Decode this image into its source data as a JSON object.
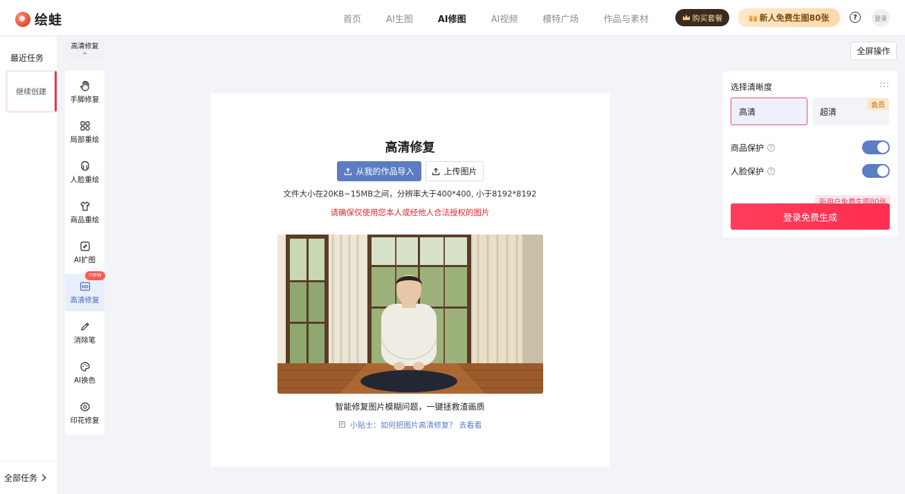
{
  "app": {
    "name": "绘蛙"
  },
  "nav": {
    "items": [
      "首页",
      "AI生图",
      "AI修图",
      "AI视频",
      "模特广场",
      "作品与素材"
    ],
    "active_index": 2,
    "buy_label": "购买套餐",
    "free_label": "新人免费生图80张",
    "help_icon": "?",
    "login_label": "登录"
  },
  "sidebar": {
    "recent_title": "最近任务",
    "continue_label": "继续创建",
    "all_tasks_label": "全部任务"
  },
  "tools": {
    "header_label": "高清修复",
    "collapse_icon": "^",
    "items": [
      {
        "label": "手脚修复",
        "icon": "hand-icon"
      },
      {
        "label": "局部重绘",
        "icon": "partial-redraw-icon"
      },
      {
        "label": "人脸重绘",
        "icon": "face-icon"
      },
      {
        "label": "商品重绘",
        "icon": "shirt-icon"
      },
      {
        "label": "AI扩图",
        "icon": "expand-icon"
      },
      {
        "label": "高清修复",
        "icon": "hd-icon",
        "badge": "new",
        "active": true
      },
      {
        "label": "消除笔",
        "icon": "eraser-pen-icon"
      },
      {
        "label": "AI换色",
        "icon": "palette-icon"
      },
      {
        "label": "印花修复",
        "icon": "print-repair-icon"
      }
    ]
  },
  "toolbar": {
    "fullscreen_label": "全屏操作"
  },
  "canvas": {
    "title": "高清修复",
    "import_label": "从我的作品导入",
    "upload_label": "上传图片",
    "file_hint": "文件大小在20KB~15MB之间，分辨率大于400*400, 小于8192*8192",
    "warning": "请确保仅使用您本人或经他人合法授权的图片",
    "photo_desc": "智能修复图片模糊问题，一键拯救渣画质",
    "tip": "小贴士：如何把图片高清修复？ 去看看"
  },
  "panel": {
    "title": "选择清晰度",
    "options": [
      "高清",
      "超清"
    ],
    "selected": "高清",
    "vip_tag": "会员",
    "product_protect_label": "商品保护",
    "product_protect_on": true,
    "face_protect_label": "人脸保护",
    "face_protect_on": true,
    "new_user_tip": "新用户免费生图80张",
    "generate_label": "登录免费生成"
  },
  "colors": {
    "accent": "#5c7cc4",
    "primary_red": "#ff2e51",
    "warning": "#e3242b"
  }
}
